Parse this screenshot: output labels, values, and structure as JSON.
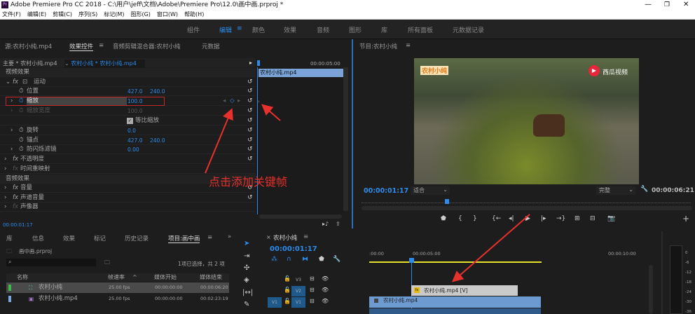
{
  "window": {
    "title": "Adobe Premiere Pro CC 2018 - C:\\用户\\jeff\\文档\\Adobe\\Premiere Pro\\12.0\\画中画.prproj *",
    "app_icon": "Pr",
    "controls": [
      "minimize",
      "maximize",
      "close"
    ]
  },
  "menu": [
    "文件(F)",
    "编辑(E)",
    "剪辑(C)",
    "序列(S)",
    "标记(M)",
    "图形(G)",
    "窗口(W)",
    "帮助(H)"
  ],
  "workspaces": [
    "组件",
    "编辑",
    "颜色",
    "效果",
    "音频",
    "图形",
    "库",
    "所有面板",
    "元数据记录"
  ],
  "active_workspace": "编辑",
  "effect_panel": {
    "tabs": [
      "源:农村小纯.mp4",
      "效果控件",
      "音频剪辑混合器:农村小纯",
      "元数据"
    ],
    "master": "主要 * 农村小纯.mp4",
    "clip": "农村小纯 * 农村小纯.mp4",
    "timecode_end": "00:00:05:00",
    "clip_bar": "农村小纯.mp4",
    "video_effects": "视频效果",
    "motion": "运动",
    "props": [
      {
        "name": "位置",
        "v1": "427.0",
        "v2": "240.0"
      },
      {
        "name": "缩放",
        "v1": "100.0"
      },
      {
        "name": "缩放宽度",
        "v1": "100.0"
      },
      {
        "name": "等比缩放",
        "checked": true
      },
      {
        "name": "旋转",
        "v1": "0.0"
      },
      {
        "name": "锚点",
        "v1": "427.0",
        "v2": "240.0"
      },
      {
        "name": "防闪烁滤镜",
        "v1": "0.00"
      }
    ],
    "opacity": "不透明度",
    "time_remap": "时间重映射",
    "audio_effects": "音频效果",
    "audio": [
      "音量",
      "声道音量",
      "声像器"
    ],
    "current_time": "00:00:01:17",
    "annotation": "点击添加关键帧"
  },
  "program": {
    "title": "节目:农村小纯",
    "overlay_left": "农村小纯",
    "overlay_right": "西瓜视频",
    "timecode": "00:00:01:17",
    "fit": "适合",
    "quality": "完整",
    "duration": "00:00:06:21",
    "playhead_fraction": 0.26
  },
  "project": {
    "tabs": [
      "库",
      "信息",
      "效果",
      "标记",
      "历史记录",
      "项目:画中画"
    ],
    "file": "画中画.prproj",
    "search_placeholder": "",
    "selection": "1项已选择，共 2 项",
    "columns": [
      "名称",
      "帧速率",
      "媒体开始",
      "媒体结束"
    ],
    "items": [
      {
        "name": "农村小纯",
        "fps": "25.00 fps",
        "start": "00:00:00:00",
        "end": "00:00:06:20",
        "color": "#3db84a"
      },
      {
        "name": "农村小纯.mp4",
        "fps": "25.00 fps",
        "start": "00:00:00:00",
        "end": "00:02:23:19",
        "color": "#7aa7e0"
      }
    ]
  },
  "timeline": {
    "title": "农村小纯",
    "timecode": "00:00:01:17",
    "ruler": [
      ":00:00",
      "00:00:05:00",
      "00:00:10:00"
    ],
    "tracks": [
      "V3",
      "V2",
      "V1"
    ],
    "source_patch": "V1",
    "clip_v2": "农村小纯.mp4 [V]",
    "clip_v1": "农村小纯.mp4"
  },
  "meter": {
    "ticks": [
      "0",
      "-6",
      "-12",
      "-18",
      "-24",
      "-30",
      "-36"
    ]
  }
}
